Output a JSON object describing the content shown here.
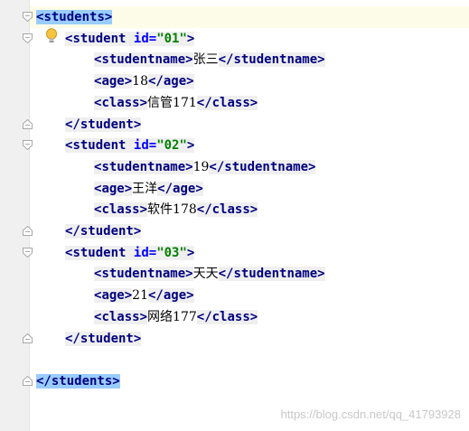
{
  "editor": {
    "lines": [
      {
        "indent": 0,
        "open": "students",
        "highlight": true
      },
      {
        "indent": 1,
        "open": "student",
        "attr_name": "id",
        "attr_value": "\"01\""
      },
      {
        "indent": 2,
        "open": "studentname",
        "text": "张三",
        "close": "studentname"
      },
      {
        "indent": 2,
        "open": "age",
        "text": "18",
        "close": "age"
      },
      {
        "indent": 2,
        "open": "class",
        "text": "信管171",
        "close": "class"
      },
      {
        "indent": 1,
        "close": "student"
      },
      {
        "indent": 1,
        "open": "student",
        "attr_name": "id",
        "attr_value": "\"02\""
      },
      {
        "indent": 2,
        "open": "studentname",
        "text": "19",
        "close": "studentname"
      },
      {
        "indent": 2,
        "open": "age",
        "text": "王洋",
        "close": "age"
      },
      {
        "indent": 2,
        "open": "class",
        "text": "软件178",
        "close": "class"
      },
      {
        "indent": 1,
        "close": "student"
      },
      {
        "indent": 1,
        "open": "student",
        "attr_name": "id",
        "attr_value": "\"03\""
      },
      {
        "indent": 2,
        "open": "studentname",
        "text": "天天",
        "close": "studentname"
      },
      {
        "indent": 2,
        "open": "age",
        "text": "21",
        "close": "age"
      },
      {
        "indent": 2,
        "open": "class",
        "text": "网络177",
        "close": "class"
      },
      {
        "indent": 1,
        "close": "student"
      },
      {
        "indent": 0,
        "blank": true
      },
      {
        "indent": 0,
        "close": "students",
        "highlight": true
      }
    ],
    "intention_icon": "lightbulb-icon"
  },
  "watermark": "https://blog.csdn.net/qq_41793928",
  "colors": {
    "tag": "#000080",
    "attr_name": "#0000ff",
    "attr_value": "#008000",
    "tag_bg": "#efefef",
    "match_highlight": "#99ccff",
    "caret_row": "#fdfce8",
    "gutter": "#f0f0f0"
  }
}
